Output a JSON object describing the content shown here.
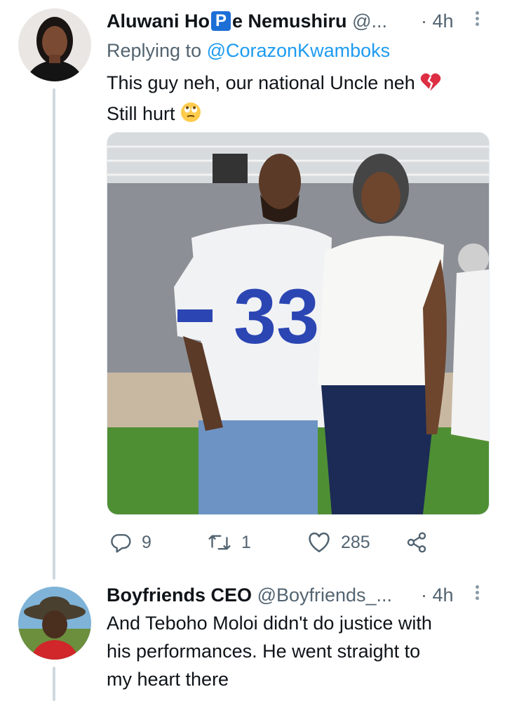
{
  "tweets": [
    {
      "name_before_badge": "Aluwani Ho",
      "name_badge": "P",
      "name_after_badge": "e Nemushiru",
      "handle": "@...",
      "dot": "·",
      "time": "4h",
      "reply_prefix": "Replying to ",
      "reply_to": "@CorazonKwamboks",
      "text_line1": "This guy neh, our national Uncle neh",
      "text_line2": "Still hurt",
      "emoji_line1": "broken-heart-emoji",
      "emoji_line2": "face-with-rolling-eyes-emoji",
      "jersey_number": "33",
      "stats": {
        "replies": "9",
        "retweets": "1",
        "likes": "285"
      }
    },
    {
      "name": "Boyfriends CEO",
      "handle": "@Boyfriends_...",
      "dot": "·",
      "time": "4h",
      "text_lines": [
        "And Teboho Moloi didn't do justice with",
        "his performances. He went straight to",
        "my heart there"
      ]
    }
  ],
  "colors": {
    "accent": "#1d9bf0",
    "secondary_text": "#536471",
    "thread_line": "#cfd9de",
    "like_icon": "#536471"
  }
}
